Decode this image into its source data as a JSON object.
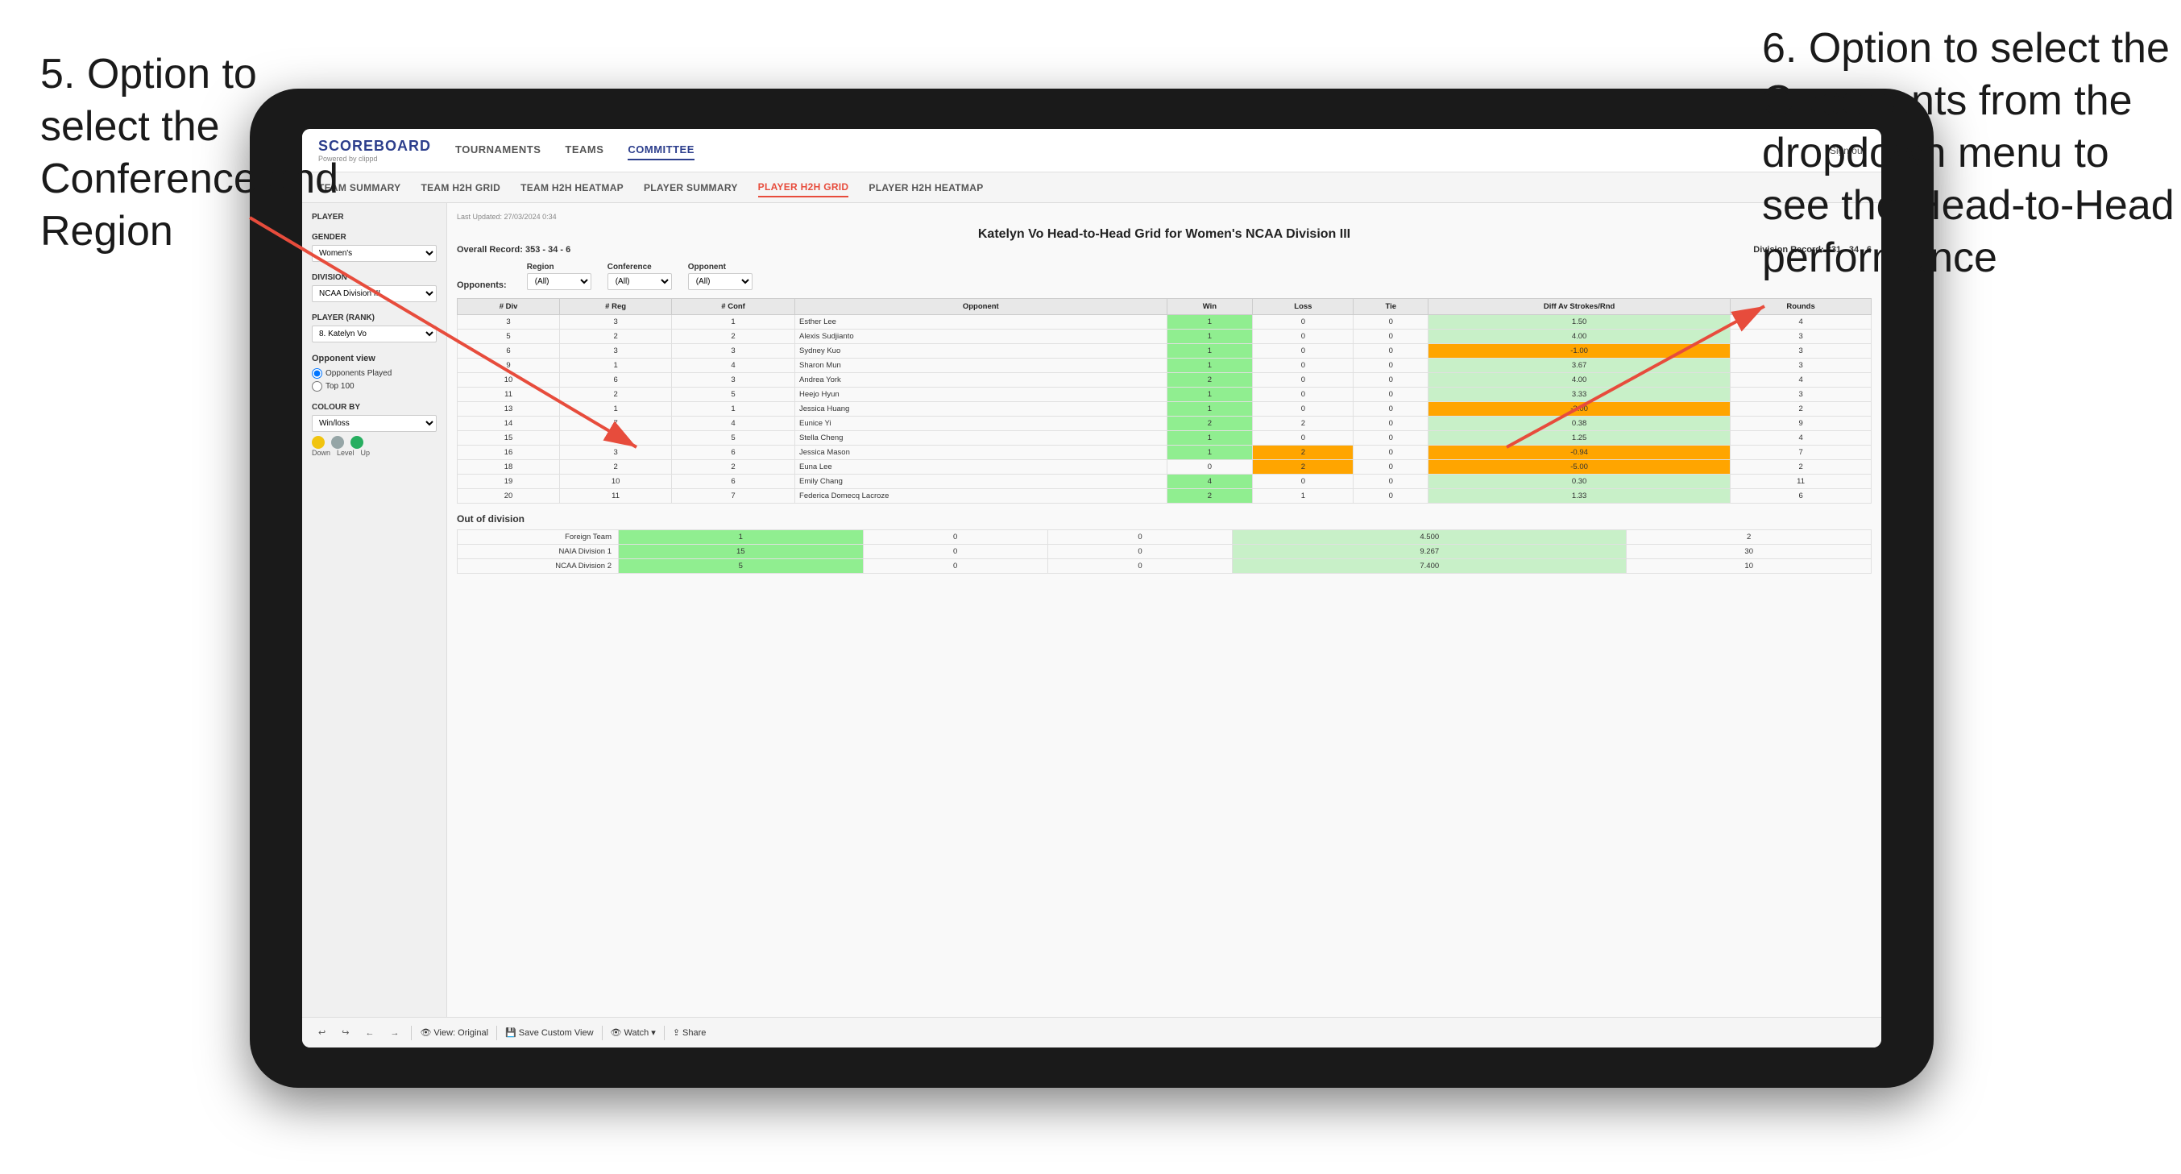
{
  "annotations": {
    "left_title": "5. Option to select the Conference and Region",
    "right_title": "6. Option to select the Opponents from the dropdown menu to see the Head-to-Head performance"
  },
  "app": {
    "logo": "SCOREBOARD",
    "logo_sub": "Powered by clippd",
    "sign_out": "Sign out",
    "nav": [
      "TOURNAMENTS",
      "TEAMS",
      "COMMITTEE"
    ],
    "active_nav": "COMMITTEE",
    "subnav": [
      "TEAM SUMMARY",
      "TEAM H2H GRID",
      "TEAM H2H HEATMAP",
      "PLAYER SUMMARY",
      "PLAYER H2H GRID",
      "PLAYER H2H HEATMAP"
    ],
    "active_subnav": "PLAYER H2H GRID"
  },
  "sidebar": {
    "player_section": "Player",
    "gender_label": "Gender",
    "gender_value": "Women's",
    "division_label": "Division",
    "division_value": "NCAA Division III",
    "player_rank_label": "Player (Rank)",
    "player_rank_value": "8. Katelyn Vo",
    "opponent_view_label": "Opponent view",
    "radio_opponents": "Opponents Played",
    "radio_top100": "Top 100",
    "colour_label": "Colour by",
    "colour_value": "Win/loss",
    "colour_labels": [
      "Down",
      "Level",
      "Up"
    ]
  },
  "report": {
    "last_updated": "Last Updated: 27/03/2024 0:34",
    "title": "Katelyn Vo Head-to-Head Grid for Women's NCAA Division III",
    "overall_record_label": "Overall Record:",
    "overall_record": "353 - 34 - 6",
    "division_record_label": "Division Record:",
    "division_record": "331 - 34 - 6",
    "filter_region_label": "Region",
    "filter_conference_label": "Conference",
    "filter_opponent_label": "Opponent",
    "opponents_label": "Opponents:",
    "filter_all": "(All)",
    "columns": [
      "# Div",
      "# Reg",
      "# Conf",
      "Opponent",
      "Win",
      "Loss",
      "Tie",
      "Diff Av Strokes/Rnd",
      "Rounds"
    ],
    "rows": [
      {
        "div": 3,
        "reg": 3,
        "conf": 1,
        "opponent": "Esther Lee",
        "win": 1,
        "loss": 0,
        "tie": 0,
        "diff": "1.50",
        "rounds": 4,
        "win_color": "green"
      },
      {
        "div": 5,
        "reg": 2,
        "conf": 2,
        "opponent": "Alexis Sudjianto",
        "win": 1,
        "loss": 0,
        "tie": 0,
        "diff": "4.00",
        "rounds": 3,
        "win_color": "green"
      },
      {
        "div": 6,
        "reg": 3,
        "conf": 3,
        "opponent": "Sydney Kuo",
        "win": 1,
        "loss": 0,
        "tie": 0,
        "diff": "-1.00",
        "rounds": 3,
        "win_color": "yellow"
      },
      {
        "div": 9,
        "reg": 1,
        "conf": 4,
        "opponent": "Sharon Mun",
        "win": 1,
        "loss": 0,
        "tie": 0,
        "diff": "3.67",
        "rounds": 3,
        "win_color": "green"
      },
      {
        "div": 10,
        "reg": 6,
        "conf": 3,
        "opponent": "Andrea York",
        "win": 2,
        "loss": 0,
        "tie": 0,
        "diff": "4.00",
        "rounds": 4,
        "win_color": "green"
      },
      {
        "div": 11,
        "reg": 2,
        "conf": 5,
        "opponent": "Heejo Hyun",
        "win": 1,
        "loss": 0,
        "tie": 0,
        "diff": "3.33",
        "rounds": 3,
        "win_color": "green"
      },
      {
        "div": 13,
        "reg": 1,
        "conf": 1,
        "opponent": "Jessica Huang",
        "win": 1,
        "loss": 0,
        "tie": 0,
        "diff": "-3.00",
        "rounds": 2,
        "win_color": "yellow"
      },
      {
        "div": 14,
        "reg": 7,
        "conf": 4,
        "opponent": "Eunice Yi",
        "win": 2,
        "loss": 2,
        "tie": 0,
        "diff": "0.38",
        "rounds": 9,
        "win_color": "yellow"
      },
      {
        "div": 15,
        "reg": 8,
        "conf": 5,
        "opponent": "Stella Cheng",
        "win": 1,
        "loss": 0,
        "tie": 0,
        "diff": "1.25",
        "rounds": 4,
        "win_color": "green"
      },
      {
        "div": 16,
        "reg": 3,
        "conf": 6,
        "opponent": "Jessica Mason",
        "win": 1,
        "loss": 2,
        "tie": 0,
        "diff": "-0.94",
        "rounds": 7,
        "win_color": "yellow"
      },
      {
        "div": 18,
        "reg": 2,
        "conf": 2,
        "opponent": "Euna Lee",
        "win": 0,
        "loss": 2,
        "tie": 0,
        "diff": "-5.00",
        "rounds": 2,
        "win_color": "red"
      },
      {
        "div": 19,
        "reg": 10,
        "conf": 6,
        "opponent": "Emily Chang",
        "win": 4,
        "loss": 0,
        "tie": 0,
        "diff": "0.30",
        "rounds": 11,
        "win_color": "green"
      },
      {
        "div": 20,
        "reg": 11,
        "conf": 7,
        "opponent": "Federica Domecq Lacroze",
        "win": 2,
        "loss": 1,
        "tie": 0,
        "diff": "1.33",
        "rounds": 6,
        "win_color": "yellow"
      }
    ],
    "out_of_division_title": "Out of division",
    "out_of_division_rows": [
      {
        "name": "Foreign Team",
        "win": 1,
        "loss": 0,
        "tie": 0,
        "diff": "4.500",
        "rounds": 2,
        "win_color": ""
      },
      {
        "name": "NAIA Division 1",
        "win": 15,
        "loss": 0,
        "tie": 0,
        "diff": "9.267",
        "rounds": 30,
        "win_color": "green"
      },
      {
        "name": "NCAA Division 2",
        "win": 5,
        "loss": 0,
        "tie": 0,
        "diff": "7.400",
        "rounds": 10,
        "win_color": "green"
      }
    ]
  },
  "toolbar": {
    "undo": "↩",
    "redo": "↪",
    "back": "←",
    "forward": "→",
    "view_original": "View: Original",
    "save_custom_view": "Save Custom View",
    "watch": "Watch ▾",
    "share": "Share"
  }
}
